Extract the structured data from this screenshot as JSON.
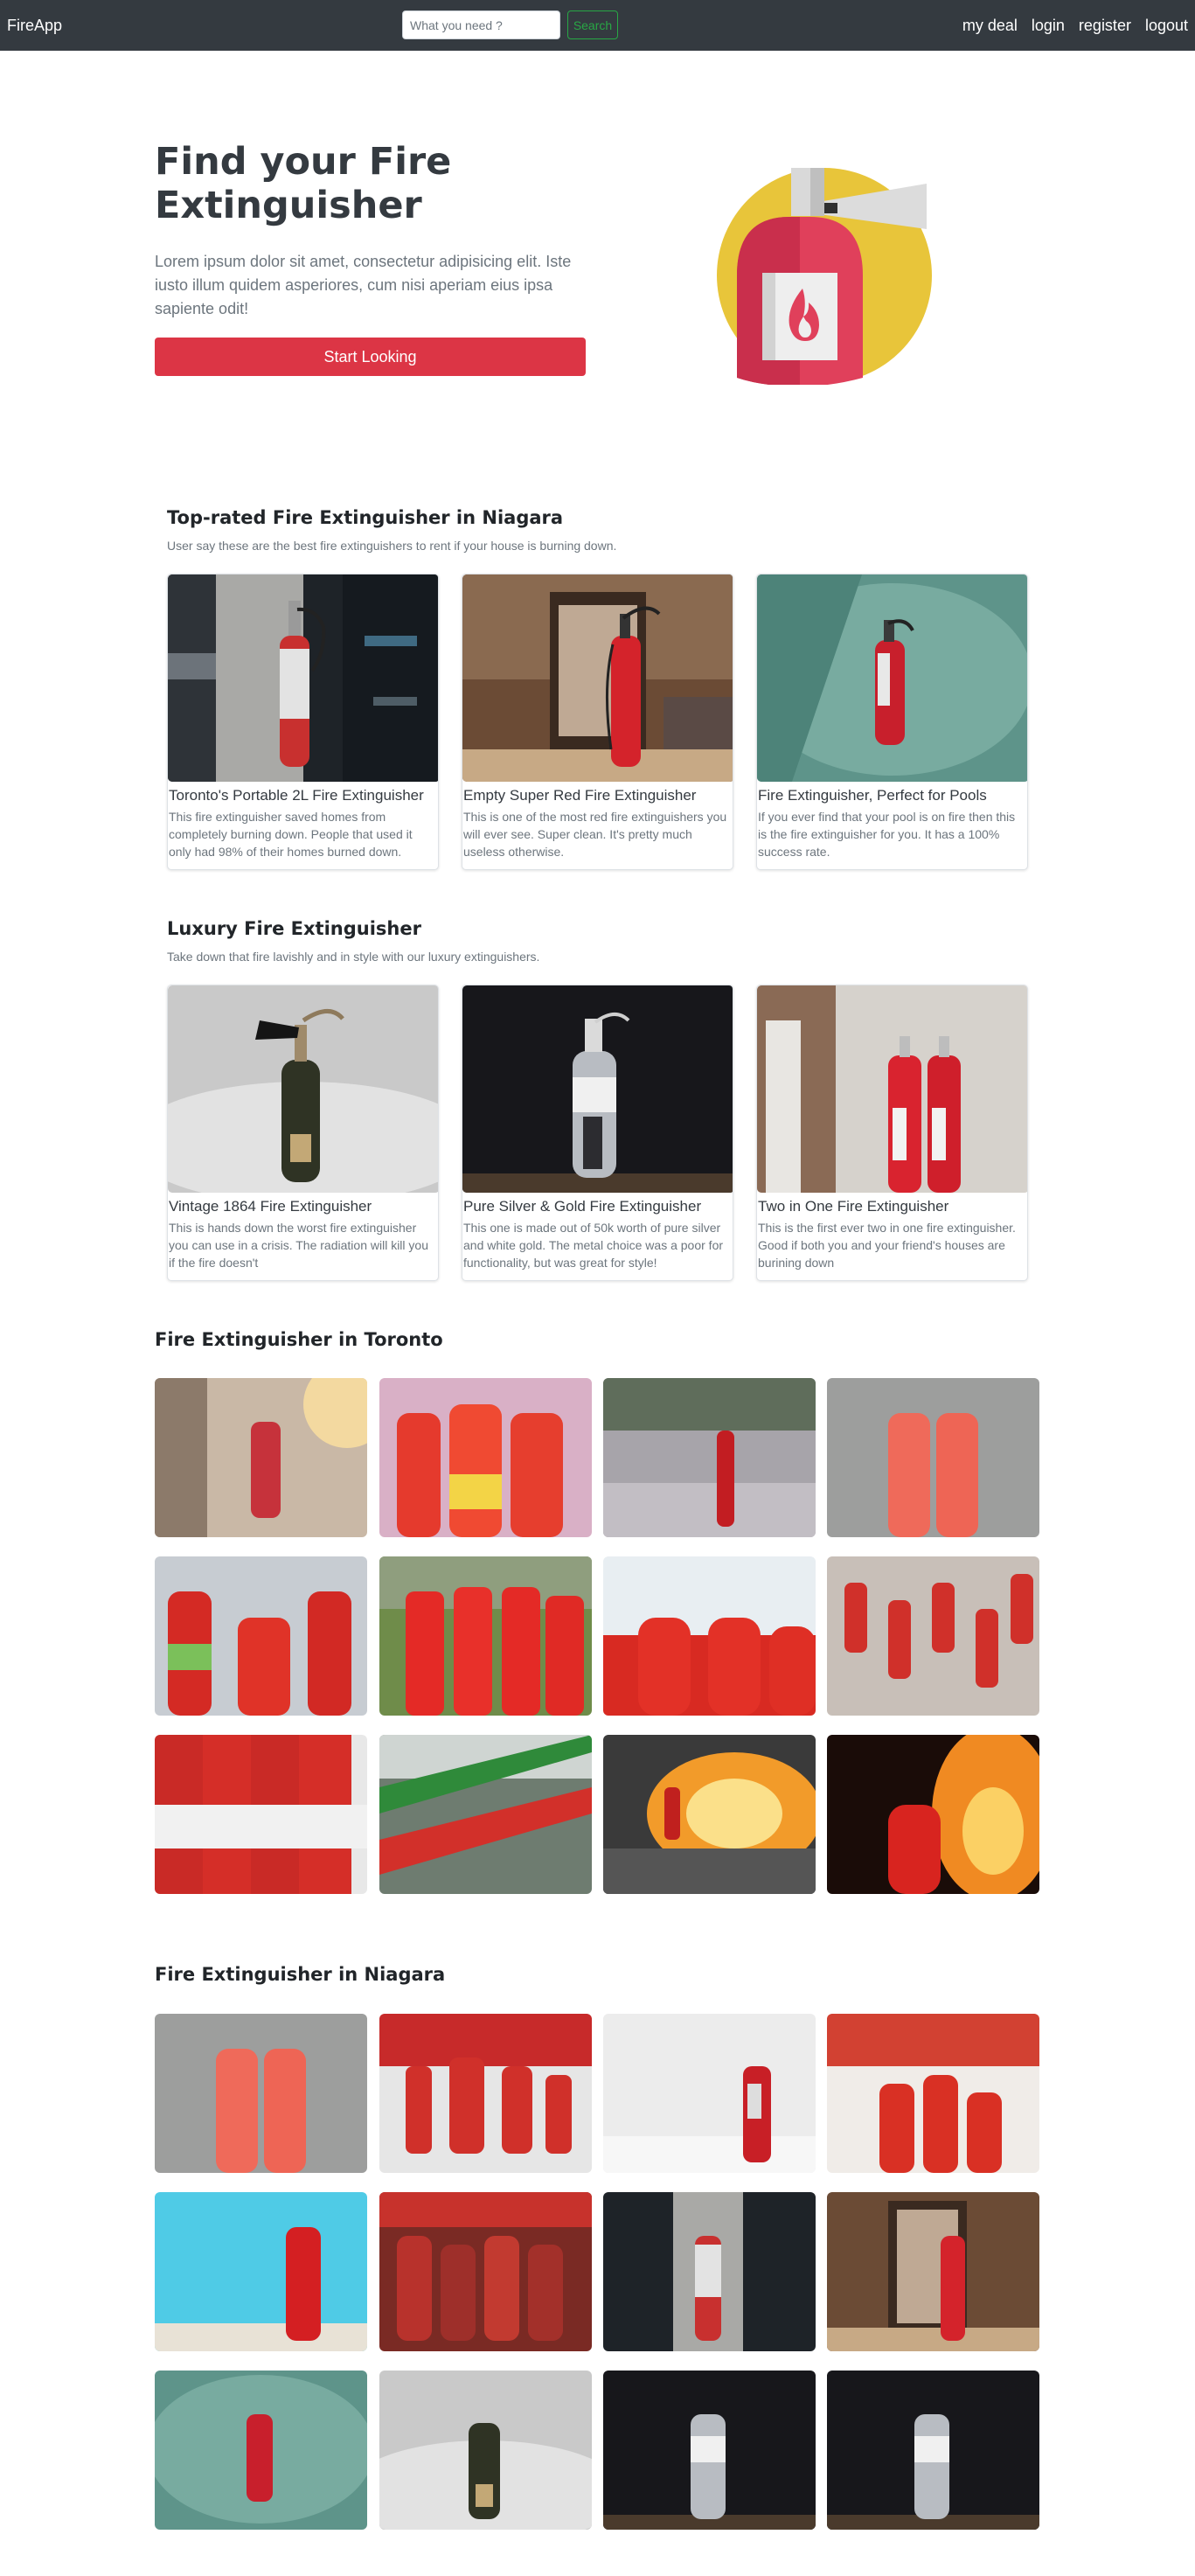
{
  "navbar": {
    "brand": "FireApp",
    "search_placeholder": "What you need ?",
    "search_button": "Search",
    "links": [
      "my deal",
      "login",
      "register",
      "logout"
    ]
  },
  "hero": {
    "title": "Find your Fire Extinguisher",
    "text": "Lorem ipsum dolor sit amet, consectetur adipisicing elit. Iste iusto illum quidem asperiores, cum nisi aperiam eius ipsa sapiente odit!",
    "button": "Start Looking",
    "illustration": "fire-extinguisher-illustration"
  },
  "top_rated": {
    "title": "Top-rated Fire Extinguisher in Niagara",
    "subtitle": "User say these are the best fire extinguishers to rent if your house is burning down.",
    "cards": [
      {
        "title": "Toronto's Portable 2L Fire Extinguisher",
        "text": "This fire extinguisher saved homes from completely burning down. People that used it only had 98% of their homes burned down."
      },
      {
        "title": "Empty Super Red Fire Extinguisher",
        "text": "This is one of the most red fire extinguishers you will ever see. Super clean. It's pretty much useless otherwise."
      },
      {
        "title": "Fire Extinguisher, Perfect for Pools",
        "text": "If you ever find that your pool is on fire then this is the fire extinguisher for you. It has a 100% success rate."
      }
    ]
  },
  "luxury": {
    "title": "Luxury Fire Extinguisher",
    "subtitle": "Take down that fire lavishly and in style with our luxury extinguishers.",
    "cards": [
      {
        "title": "Vintage 1864 Fire Extinguisher",
        "text": "This is hands down the worst fire extinguisher you can use in a crisis. The radiation will kill you if the fire doesn't"
      },
      {
        "title": "Pure Silver & Gold Fire Extinguisher",
        "text": "This one is made out of 50k worth of pure silver and white gold. The metal choice was a poor for functionality, but was great for style!"
      },
      {
        "title": "Two in One Fire Extinguisher",
        "text": "This is the first ever two in one fire extinguisher. Good if both you and your friend's houses are burining down"
      }
    ]
  },
  "toronto": {
    "title": "Fire Extinguisher in Toronto"
  },
  "niagara": {
    "title": "Fire Extinguisher in Niagara"
  },
  "colors": {
    "navbar": "#343a40",
    "primary_button": "#dc3545",
    "search_outline": "#28a745",
    "illustration_circle": "#e8c53a"
  }
}
